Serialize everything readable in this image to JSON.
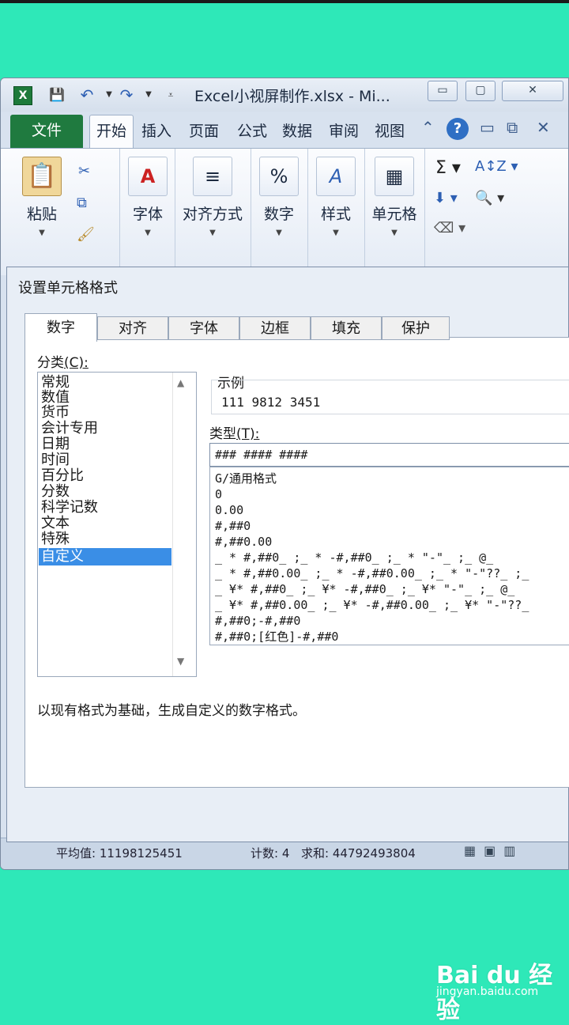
{
  "window": {
    "title": "Excel小视屏制作.xlsx - Mi...",
    "minimize": "▭",
    "maximize": "▢",
    "close": "✕"
  },
  "ribbon": {
    "tabs": {
      "file": "文件",
      "home": "开始",
      "insert": "插入",
      "page": "页面",
      "formula": "公式",
      "data": "数据",
      "review": "审阅",
      "view": "视图"
    },
    "groups": {
      "paste": "粘贴",
      "font": "字体",
      "align": "对齐方式",
      "number": "数字",
      "style": "样式",
      "cells": "单元格"
    }
  },
  "dialog": {
    "title": "设置单元格格式",
    "tabs": [
      "数字",
      "对齐",
      "字体",
      "边框",
      "填充",
      "保护"
    ],
    "category_label": "分类",
    "category_key": "(C):",
    "categories": [
      "常规",
      "数值",
      "货币",
      "会计专用",
      "日期",
      "时间",
      "百分比",
      "分数",
      "科学记数",
      "文本",
      "特殊",
      "自定义"
    ],
    "selected_category": "自定义",
    "sample_label": "示例",
    "sample_value": "111 9812 3451",
    "type_label": "类型",
    "type_key": "(T):",
    "type_value": "### #### ####",
    "formats": [
      "G/通用格式",
      "0",
      "0.00",
      "#,##0",
      "#,##0.00",
      "_ * #,##0_ ;_ * -#,##0_ ;_ * \"-\"_ ;_ @_",
      "_ * #,##0.00_ ;_ * -#,##0.00_ ;_ * \"-\"??_ ;_",
      "_ ¥* #,##0_ ;_ ¥* -#,##0_ ;_ ¥* \"-\"_ ;_ @_",
      "_ ¥* #,##0.00_ ;_ ¥* -#,##0.00_ ;_ ¥* \"-\"??_",
      "#,##0;-#,##0",
      "#,##0;[红色]-#,##0"
    ],
    "description": "以现有格式为基础，生成自定义的数字格式。"
  },
  "statusbar": {
    "average": "平均值: 11198125451",
    "count": "计数: 4",
    "sum": "求和: 44792493804"
  },
  "watermark": {
    "logo": "Bai du 经验",
    "url": "jingyan.baidu.com"
  },
  "colors": {
    "background": "#2ee8b8",
    "file_tab": "#1f7a3f",
    "selection": "#3a8ee6"
  }
}
